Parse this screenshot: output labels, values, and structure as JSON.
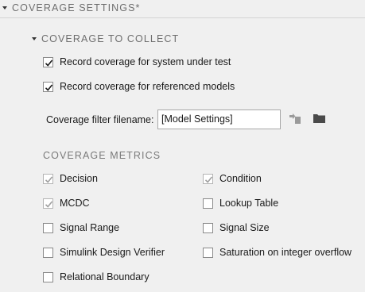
{
  "coverage_settings": {
    "title": "COVERAGE SETTINGS*",
    "collect": {
      "title": "COVERAGE TO COLLECT",
      "system_under_test": {
        "label": "Record coverage for system under test",
        "checked": true
      },
      "referenced_models": {
        "label": "Record coverage for referenced models",
        "checked": true
      },
      "filter": {
        "label": "Coverage filter filename:",
        "value": "[Model Settings]",
        "icons": [
          "import-filter-icon",
          "folder-icon"
        ]
      }
    },
    "metrics": {
      "title": "COVERAGE METRICS",
      "decision": {
        "label": "Decision",
        "checked": true,
        "enabled": false
      },
      "condition": {
        "label": "Condition",
        "checked": true,
        "enabled": false
      },
      "mcdc": {
        "label": "MCDC",
        "checked": true,
        "enabled": false
      },
      "lookup_table": {
        "label": "Lookup Table",
        "checked": false,
        "enabled": true
      },
      "signal_range": {
        "label": "Signal Range",
        "checked": false,
        "enabled": true
      },
      "signal_size": {
        "label": "Signal Size",
        "checked": false,
        "enabled": true
      },
      "sldv": {
        "label": "Simulink Design Verifier",
        "checked": false,
        "enabled": true
      },
      "saturation": {
        "label": "Saturation on integer overflow",
        "checked": false,
        "enabled": true
      },
      "relational_boundary": {
        "label": "Relational Boundary",
        "checked": false,
        "enabled": true
      }
    }
  }
}
